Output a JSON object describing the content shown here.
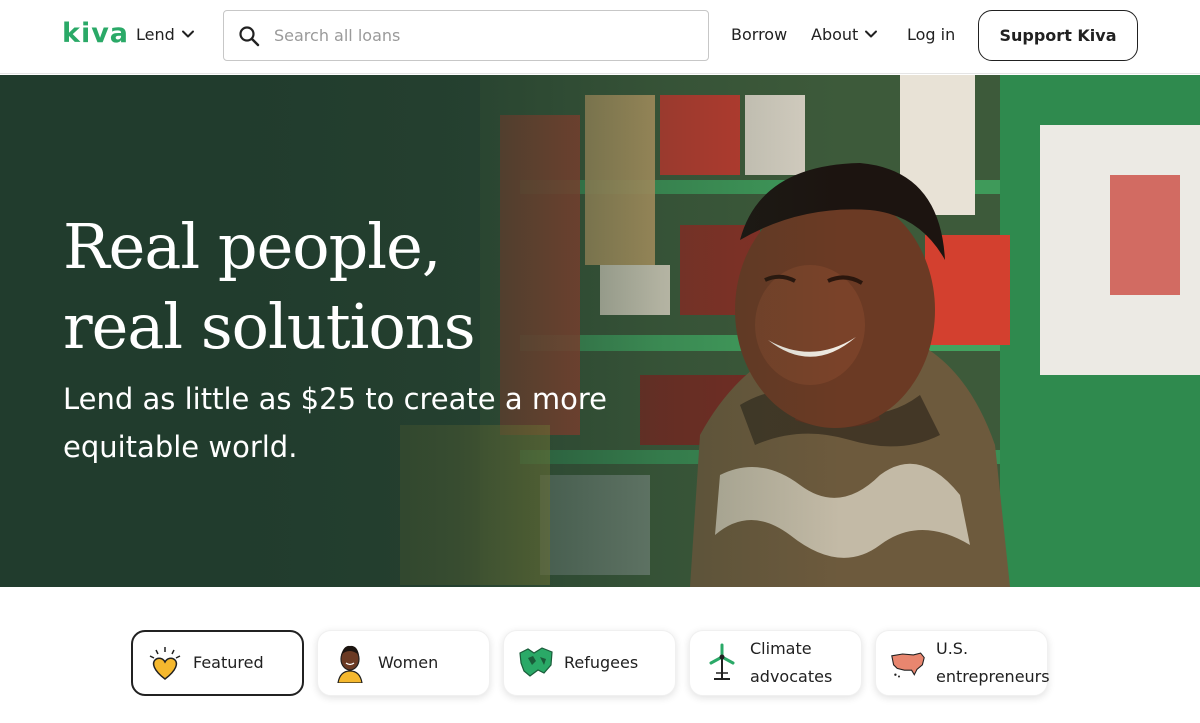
{
  "header": {
    "logo": "kiva",
    "lend": "Lend",
    "search_placeholder": "Search all loans",
    "borrow": "Borrow",
    "about": "About",
    "login": "Log in",
    "support": "Support Kiva"
  },
  "hero": {
    "title_line1": "Real people,",
    "title_line2": "real solutions",
    "subtitle_line1": "Lend as little as $25 to create a more",
    "subtitle_line2": "equitable world."
  },
  "categories": [
    {
      "label": "Featured",
      "icon": "heart-icon",
      "active": true
    },
    {
      "label": "Women",
      "icon": "woman-icon",
      "active": false
    },
    {
      "label": "Refugees",
      "icon": "map-icon",
      "active": false
    },
    {
      "label": "Climate advocates",
      "icon": "wind-turbine-icon",
      "active": false
    },
    {
      "label": "U.S. entrepreneurs",
      "icon": "us-map-icon",
      "active": false
    }
  ],
  "colors": {
    "brand_green": "#2aa967",
    "hero_overlay": "#213c2d",
    "text": "#212121"
  }
}
